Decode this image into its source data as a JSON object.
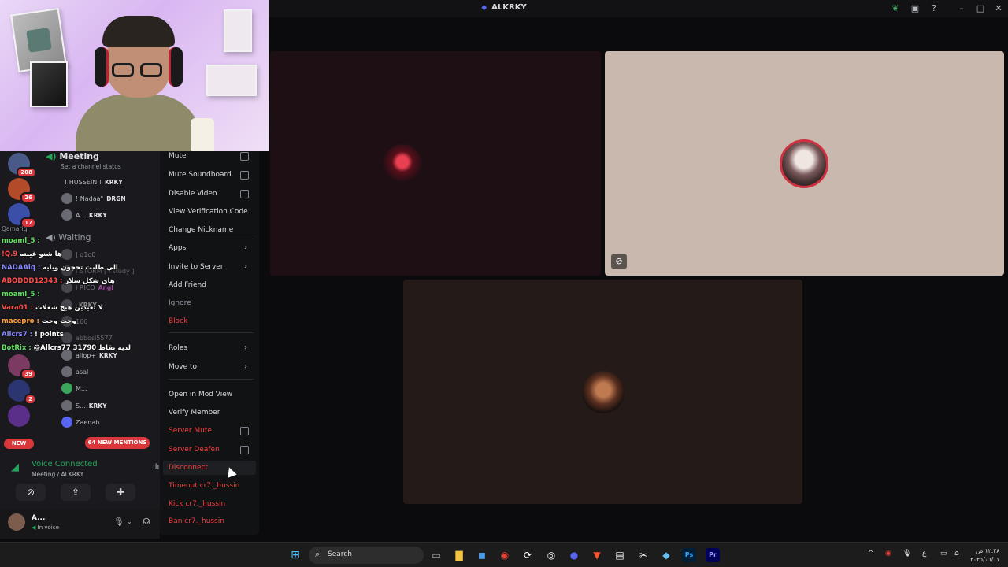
{
  "window": {
    "title": "ALKRKY"
  },
  "sidebar": {
    "guild_badges": [
      "208",
      "26",
      "17",
      "39",
      "2"
    ],
    "channels": [
      {
        "name": "Meeting",
        "status": "Set a channel status"
      },
      {
        "name": "Waiting"
      }
    ],
    "voice_users": [
      {
        "name": "! HUSSEIN !",
        "tag": "KRKY"
      },
      {
        "name": "! Nadaa\"",
        "tag": "DRGN"
      },
      {
        "name": "A...",
        "tag": "KRKY"
      },
      {
        "name": "| q1o0"
      },
      {
        "name": "I STORM [ i study ]"
      },
      {
        "name": "I RICO",
        "tag": "Angl"
      },
      {
        "name": "",
        "tag": "KRKY"
      },
      {
        "name": "166"
      },
      {
        "name": "abbosi5577"
      },
      {
        "name": "aliop+",
        "tag": "KRKY"
      },
      {
        "name": "asal"
      },
      {
        "name": "M..."
      },
      {
        "name": "S...",
        "tag": "KRKY"
      },
      {
        "name": "Zaenab"
      }
    ],
    "chat": [
      {
        "user": "Qamariq",
        "msg": ""
      },
      {
        "user": "moaml_5 :",
        "msg": ""
      },
      {
        "user": "!Q.9",
        "msg": "ها شنو غيبته"
      },
      {
        "user": "NADAAlq :",
        "msg": "الي طلبت تحچون ويايه"
      },
      {
        "user": "ABODDD12343 :",
        "msg": "هاي شكل سلار"
      },
      {
        "user": "moaml_5 :",
        "msg": ""
      },
      {
        "user": "Vara01 :",
        "msg": "لا تعيدين هيچ شغلات"
      },
      {
        "user": "macepro :",
        "msg": "وجت وجت"
      },
      {
        "user": "Allcrs7 :",
        "msg": "! points"
      },
      {
        "user": "BotRix :",
        "msg": "@Allcrs77 31790 لديه نقاط"
      }
    ],
    "mentions_label": "64 NEW MENTIONS",
    "new_label": "NEW",
    "voice_panel": {
      "status": "Voice Connected",
      "location": "Meeting / ALKRKY"
    },
    "user": {
      "name": "A...",
      "status": "In voice"
    }
  },
  "context_menu": {
    "items": [
      {
        "label": "Mute",
        "type": "checkbox"
      },
      {
        "label": "Mute Soundboard",
        "type": "checkbox"
      },
      {
        "label": "Disable Video",
        "type": "checkbox"
      },
      {
        "label": "View Verification Code"
      },
      {
        "label": "Change Nickname"
      },
      {
        "label": "Apps",
        "type": "submenu"
      },
      {
        "label": "Invite to Server",
        "type": "submenu"
      },
      {
        "label": "Add Friend"
      },
      {
        "label": "Ignore"
      },
      {
        "label": "Block"
      },
      {
        "label": "Roles",
        "type": "submenu"
      },
      {
        "label": "Move to",
        "type": "submenu"
      },
      {
        "label": "Open in Mod View"
      },
      {
        "label": "Verify Member"
      },
      {
        "label": "Server Mute",
        "type": "checkbox"
      },
      {
        "label": "Server Deafen",
        "type": "checkbox"
      },
      {
        "label": "Disconnect"
      },
      {
        "label": "Timeout cr7._hussin"
      },
      {
        "label": "Kick cr7._hussin"
      },
      {
        "label": "Ban cr7._hussin"
      }
    ]
  },
  "taskbar": {
    "search_label": "Search",
    "clock_time": "١٢:٢٨ ص",
    "clock_date": "٢٠٢٦/٠٦/٠١"
  },
  "colors": {
    "accent": "#5865f2",
    "danger": "#f23f42",
    "connected": "#23a55a"
  }
}
